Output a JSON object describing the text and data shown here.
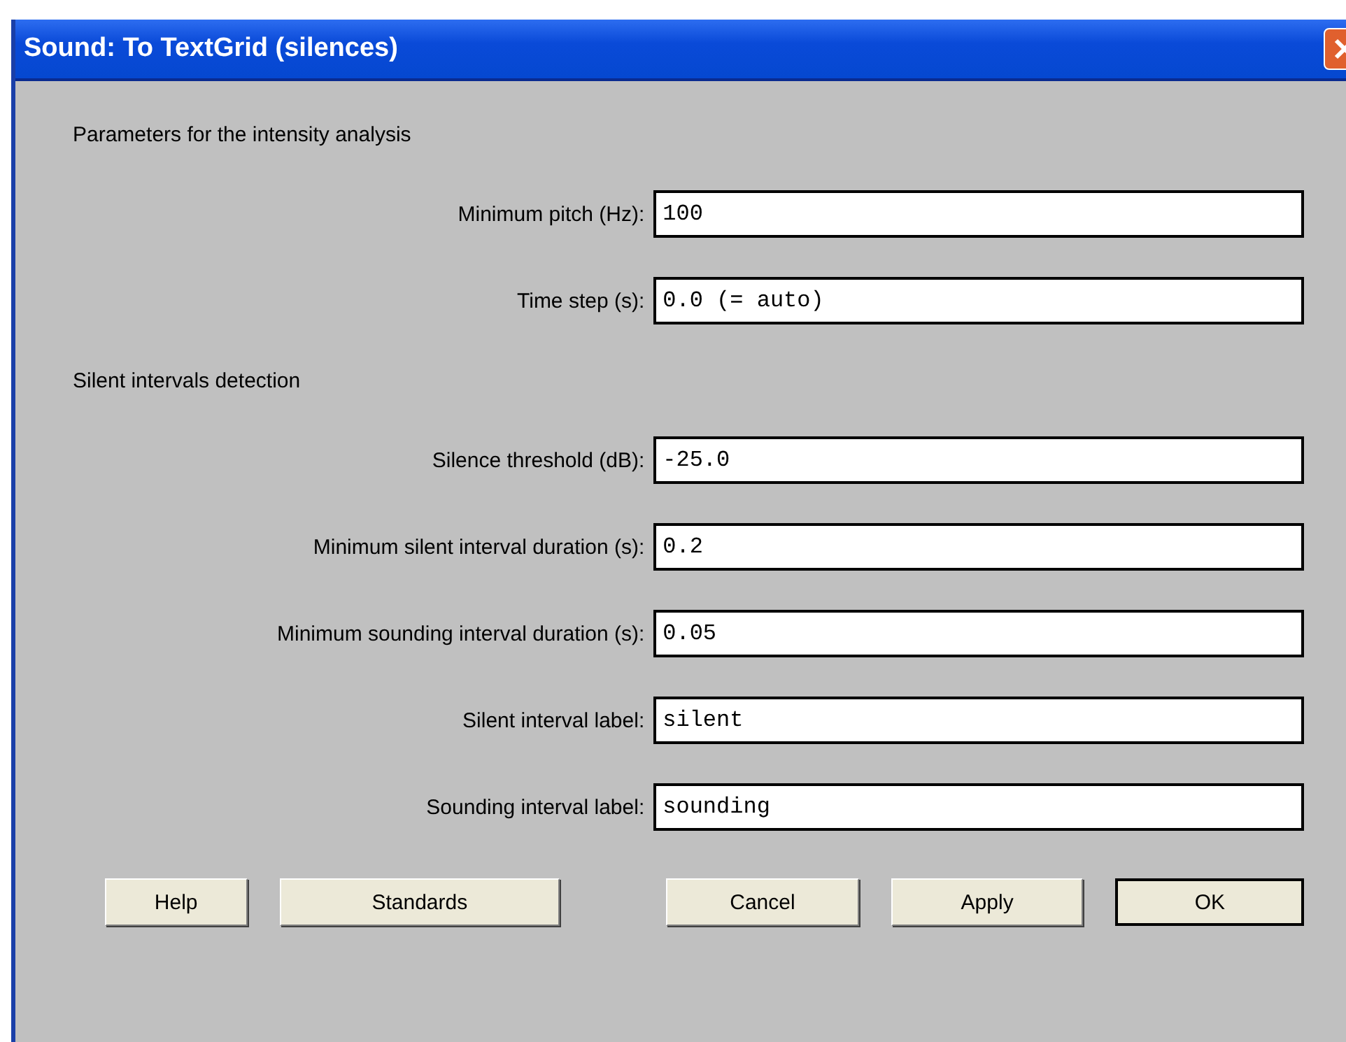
{
  "window": {
    "title": "Sound: To TextGrid (silences)"
  },
  "sections": [
    {
      "heading": "Parameters for the intensity analysis",
      "fields": [
        {
          "label": "Minimum pitch (Hz):",
          "value": "100"
        },
        {
          "label": "Time step (s):",
          "value": "0.0 (= auto)"
        }
      ]
    },
    {
      "heading": "Silent intervals detection",
      "fields": [
        {
          "label": "Silence threshold (dB):",
          "value": "-25.0"
        },
        {
          "label": "Minimum silent interval duration (s):",
          "value": "0.2"
        },
        {
          "label": "Minimum sounding interval duration (s):",
          "value": "0.05"
        },
        {
          "label": "Silent interval label:",
          "value": "silent"
        },
        {
          "label": "Sounding interval label:",
          "value": "sounding"
        }
      ]
    }
  ],
  "button_groups": [
    [
      {
        "label": "Help",
        "default": false
      },
      {
        "label": "Standards",
        "default": false
      }
    ],
    [
      {
        "label": "Cancel",
        "default": false
      },
      {
        "label": "Apply",
        "default": false
      },
      {
        "label": "OK",
        "default": true
      }
    ]
  ]
}
